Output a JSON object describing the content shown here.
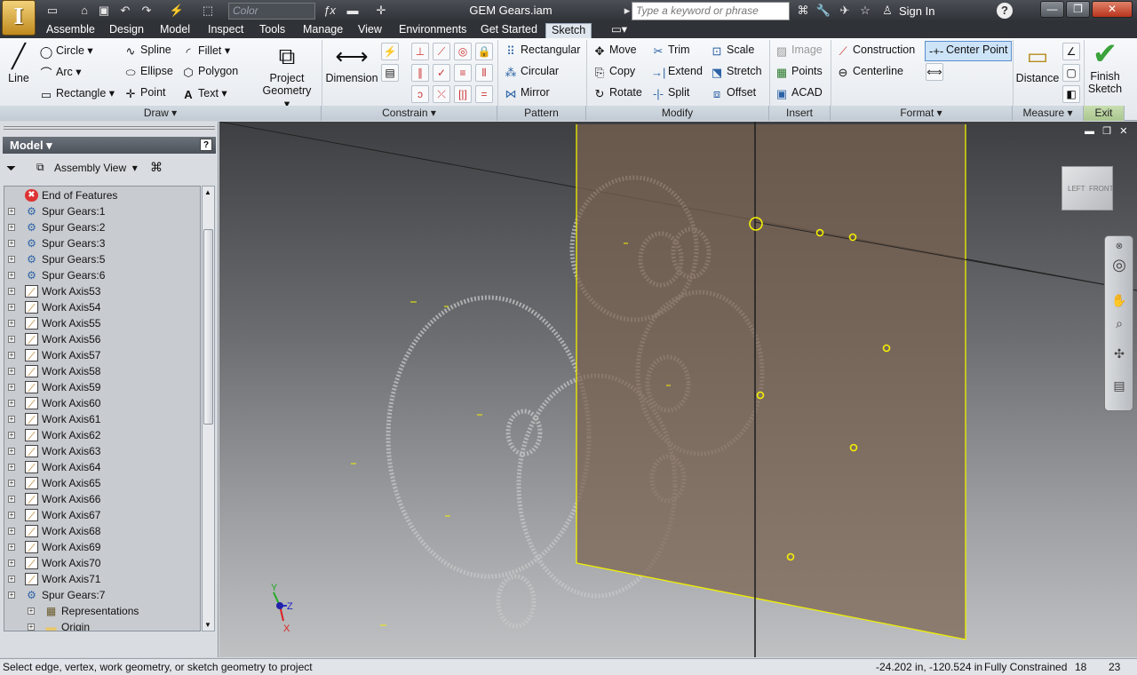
{
  "titlebar": {
    "app_letter": "I",
    "color_placeholder": "Color",
    "window_title": "GEM Gears.iam",
    "search_placeholder": "Type a keyword or phrase",
    "sign_in": "Sign In"
  },
  "tabs": [
    "Assemble",
    "Design",
    "Model",
    "Inspect",
    "Tools",
    "Manage",
    "View",
    "Environments",
    "Get Started",
    "Sketch"
  ],
  "active_tab": "Sketch",
  "ribbon": {
    "draw": {
      "line": "Line",
      "circle": "Circle",
      "arc": "Arc",
      "rectangle": "Rectangle",
      "spline": "Spline",
      "ellipse": "Ellipse",
      "point": "Point",
      "fillet": "Fillet",
      "polygon": "Polygon",
      "text": "Text",
      "project_geometry_1": "Project",
      "project_geometry_2": "Geometry",
      "panel": "Draw"
    },
    "constrain": {
      "dimension": "Dimension",
      "panel": "Constrain"
    },
    "pattern": {
      "rectangular": "Rectangular",
      "circular": "Circular",
      "mirror": "Mirror",
      "panel": "Pattern"
    },
    "modify": {
      "move": "Move",
      "copy": "Copy",
      "rotate": "Rotate",
      "trim": "Trim",
      "extend": "Extend",
      "split": "Split",
      "scale": "Scale",
      "stretch": "Stretch",
      "offset": "Offset",
      "panel": "Modify"
    },
    "insert": {
      "image": "Image",
      "points": "Points",
      "acad": "ACAD",
      "panel": "Insert"
    },
    "format": {
      "construction": "Construction",
      "centerline": "Centerline",
      "center_point": "Center Point",
      "panel": "Format"
    },
    "measure": {
      "distance": "Distance",
      "panel": "Measure"
    },
    "exit": {
      "finish_1": "Finish",
      "finish_2": "Sketch",
      "panel": "Exit"
    }
  },
  "browser": {
    "title": "Model",
    "view": "Assembly View",
    "tree": [
      {
        "label": "End of Features",
        "icon": "error-icon",
        "expand": false,
        "indent": 0
      },
      {
        "label": "Spur Gears:1",
        "icon": "gear-icon",
        "expand": true,
        "indent": 0
      },
      {
        "label": "Spur Gears:2",
        "icon": "gear-icon",
        "expand": true,
        "indent": 0
      },
      {
        "label": "Spur Gears:3",
        "icon": "gear-icon",
        "expand": true,
        "indent": 0
      },
      {
        "label": "Spur Gears:5",
        "icon": "gear-icon",
        "expand": true,
        "indent": 0
      },
      {
        "label": "Spur Gears:6",
        "icon": "gear-icon",
        "expand": true,
        "indent": 0
      },
      {
        "label": "Work Axis53",
        "icon": "work-axis-icon",
        "expand": true,
        "indent": 0
      },
      {
        "label": "Work Axis54",
        "icon": "work-axis-icon",
        "expand": true,
        "indent": 0
      },
      {
        "label": "Work Axis55",
        "icon": "work-axis-icon",
        "expand": true,
        "indent": 0
      },
      {
        "label": "Work Axis56",
        "icon": "work-axis-icon",
        "expand": true,
        "indent": 0
      },
      {
        "label": "Work Axis57",
        "icon": "work-axis-icon",
        "expand": true,
        "indent": 0
      },
      {
        "label": "Work Axis58",
        "icon": "work-axis-icon",
        "expand": true,
        "indent": 0
      },
      {
        "label": "Work Axis59",
        "icon": "work-axis-icon",
        "expand": true,
        "indent": 0
      },
      {
        "label": "Work Axis60",
        "icon": "work-axis-icon",
        "expand": true,
        "indent": 0
      },
      {
        "label": "Work Axis61",
        "icon": "work-axis-icon",
        "expand": true,
        "indent": 0
      },
      {
        "label": "Work Axis62",
        "icon": "work-axis-icon",
        "expand": true,
        "indent": 0
      },
      {
        "label": "Work Axis63",
        "icon": "work-axis-icon",
        "expand": true,
        "indent": 0
      },
      {
        "label": "Work Axis64",
        "icon": "work-axis-icon",
        "expand": true,
        "indent": 0
      },
      {
        "label": "Work Axis65",
        "icon": "work-axis-icon",
        "expand": true,
        "indent": 0
      },
      {
        "label": "Work Axis66",
        "icon": "work-axis-icon",
        "expand": true,
        "indent": 0
      },
      {
        "label": "Work Axis67",
        "icon": "work-axis-icon",
        "expand": true,
        "indent": 0
      },
      {
        "label": "Work Axis68",
        "icon": "work-axis-icon",
        "expand": true,
        "indent": 0
      },
      {
        "label": "Work Axis69",
        "icon": "work-axis-icon",
        "expand": true,
        "indent": 0
      },
      {
        "label": "Work Axis70",
        "icon": "work-axis-icon",
        "expand": true,
        "indent": 0
      },
      {
        "label": "Work Axis71",
        "icon": "work-axis-icon",
        "expand": true,
        "indent": 0
      },
      {
        "label": "Spur Gears:7",
        "icon": "gear-icon",
        "expand": true,
        "indent": 0
      },
      {
        "label": "Representations",
        "icon": "representations-icon",
        "expand": true,
        "indent": 1
      },
      {
        "label": "Origin",
        "icon": "folder-icon",
        "expand": true,
        "indent": 1
      }
    ]
  },
  "viewcube": {
    "left": "LEFT",
    "front": "FRONT"
  },
  "triad": {
    "x": "X",
    "y": "Y",
    "z": "Z"
  },
  "status": {
    "message": "Select edge, vertex, work geometry,  or sketch geometry to project",
    "coords": "-24.202 in, -120.524 in",
    "constraint": "Fully Constrained",
    "count1": "18",
    "count2": "23"
  },
  "colors": {
    "sketch_plane": "#7a6350",
    "sketch_edge": "#f0f000",
    "accent": "#3d7cc9"
  }
}
